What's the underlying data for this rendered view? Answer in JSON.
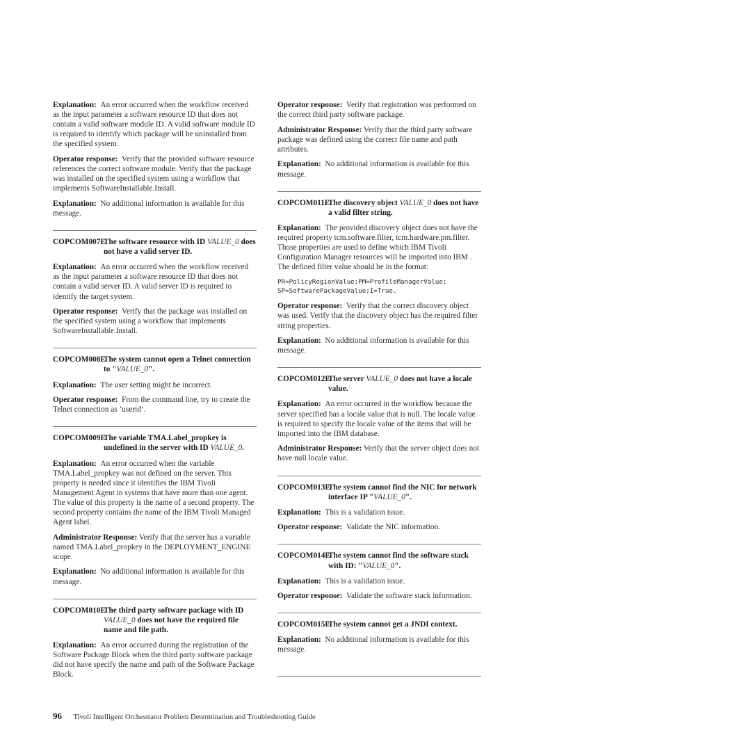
{
  "labels": {
    "explanation": "Explanation:",
    "operator": "Operator response:",
    "admin": "Administrator Response:"
  },
  "left": {
    "lead": [
      {
        "label": "Explanation:",
        "text": "An error occurred when the workflow received as the input parameter a software resource ID that does not contain a valid software module ID. A valid software module ID is required to identify which package will be uninstalled from the specified system."
      },
      {
        "label": "Operator response:",
        "text": "Verify that the provided software resource references the correct software module. Verify that the package was installed on the specified system using a workflow that implements SoftwareInstallable.Install."
      },
      {
        "label": "Explanation:",
        "text": "No additional information is available for this message."
      }
    ],
    "messages": [
      {
        "code": "COPCOM007E",
        "title_parts": [
          {
            "t": "The software resource with ID "
          },
          {
            "t": "VALUE_0",
            "i": true
          },
          {
            "t": " does not have a valid server ID."
          }
        ],
        "paras": [
          {
            "label": "Explanation:",
            "text": "An error occurred when the workflow received as the input parameter a software resource ID that does not contain a valid server ID. A valid server ID is required to identify the target system."
          },
          {
            "label": "Operator response:",
            "text": "Verify that the package was installed on the specified system using a workflow that implements SoftwareInstallable.Install."
          }
        ]
      },
      {
        "code": "COPCOM008E",
        "title_parts": [
          {
            "t": "The system cannot open a Telnet connection to \""
          },
          {
            "t": "VALUE_0",
            "i": true
          },
          {
            "t": "\"."
          }
        ],
        "paras": [
          {
            "label": "Explanation:",
            "text": "The user setting might be incorrect."
          },
          {
            "label": "Operator response:",
            "text": "From the command line, try to create the Telnet connection as ’userid’."
          }
        ]
      },
      {
        "code": "COPCOM009E",
        "title_parts": [
          {
            "t": "The variable TMA.Label_propkey is undefined in the server with ID "
          },
          {
            "t": "VALUE_0",
            "i": true
          },
          {
            "t": "."
          }
        ],
        "paras": [
          {
            "label": "Explanation:",
            "text": "An error occurred when the variable TMA.Label_propkey was not defined on the server. This property is needed since it identifies the IBM Tivoli Management Agent in systems that have more than one agent. The value of this property is the name of a second property. The second property contains the name of the IBM Tivoli Managed Agent label."
          },
          {
            "label": "Administrator Response:",
            "text": "Verify that the server has a variable named TMA.Label_propkey in the DEPLOYMENT_ENGINE scope."
          },
          {
            "label": "Explanation:",
            "text": "No additional information is available for this message."
          }
        ]
      },
      {
        "code": "COPCOM010E",
        "title_parts": [
          {
            "t": "The third party software package with ID "
          },
          {
            "t": "VALUE_0",
            "i": true
          },
          {
            "t": " does not have the required file name and file path."
          }
        ],
        "paras": [
          {
            "label": "Explanation:",
            "text": "An error occurred during the registration of the Software Package Block when the third party software package did not have specify the name and path of the Software Package Block."
          }
        ]
      }
    ]
  },
  "right": {
    "lead": [
      {
        "label": "Operator response:",
        "text": "Verify that registration was performed on the correct third party software package."
      },
      {
        "label": "Administrator Response:",
        "text": "Verify that the third party software package was defined using the correct file name and path attributes."
      },
      {
        "label": "Explanation:",
        "text": "No additional information is available for this message."
      }
    ],
    "messages": [
      {
        "code": "COPCOM011E",
        "title_parts": [
          {
            "t": "The discovery object "
          },
          {
            "t": "VALUE_0",
            "i": true
          },
          {
            "t": " does not have a valid filter string."
          }
        ],
        "paras": [
          {
            "label": "Explanation:",
            "text": "The provided discovery object does not have the required property tcm.software.filter, tcm.hardware.pm.filter. Those properties are used to define which IBM Tivoli Configuration Manager resources will be imported into IBM . The defined filter value should be in the format:"
          },
          {
            "code_lines": [
              "PR=PolicyRegionValue;PM=ProfileManagerValue;",
              "SP=SoftwarePackageValue;I=True."
            ]
          },
          {
            "label": "Operator response:",
            "text": "Verify that the correct discovery object was used. Verify that the discovery object has the required filter string properties."
          },
          {
            "label": "Explanation:",
            "text": "No additional information is available for this message."
          }
        ]
      },
      {
        "code": "COPCOM012E",
        "title_parts": [
          {
            "t": "The server "
          },
          {
            "t": "VALUE_0",
            "i": true
          },
          {
            "t": " does not have a locale value."
          }
        ],
        "paras": [
          {
            "label": "Explanation:",
            "text": "An error occurred in the workflow because the server specified has a locale value that is null. The locale value is required to specify the locale value of the items that will be imported into the IBM database."
          },
          {
            "label": "Administrator Response:",
            "text": "Verify that the server object does not have null locale value."
          }
        ]
      },
      {
        "code": "COPCOM013E",
        "title_parts": [
          {
            "t": "The system cannot find the NIC for network interface IP \""
          },
          {
            "t": "VALUE_0",
            "i": true
          },
          {
            "t": "\"."
          }
        ],
        "paras": [
          {
            "label": "Explanation:",
            "text": "This is a validation issue."
          },
          {
            "label": "Operator response:",
            "text": "Validate the NIC information."
          }
        ]
      },
      {
        "code": "COPCOM014E",
        "title_parts": [
          {
            "t": "The system cannot find the software stack with ID: \""
          },
          {
            "t": "VALUE_0",
            "i": true
          },
          {
            "t": "\"."
          }
        ],
        "paras": [
          {
            "label": "Explanation:",
            "text": "This is a validation issue."
          },
          {
            "label": "Operator response:",
            "text": "Validate the software stack information."
          }
        ]
      },
      {
        "code": "COPCOM015E",
        "title_parts": [
          {
            "t": "The system cannot get a JNDI context."
          }
        ],
        "paras": [
          {
            "label": "Explanation:",
            "text": "No additional information is available for this message."
          }
        ]
      }
    ]
  },
  "footer": {
    "page_number": "96",
    "book_title": "Tivoli Intelligent Orchestrator Problem Determination and Troubleshooting Guide"
  }
}
